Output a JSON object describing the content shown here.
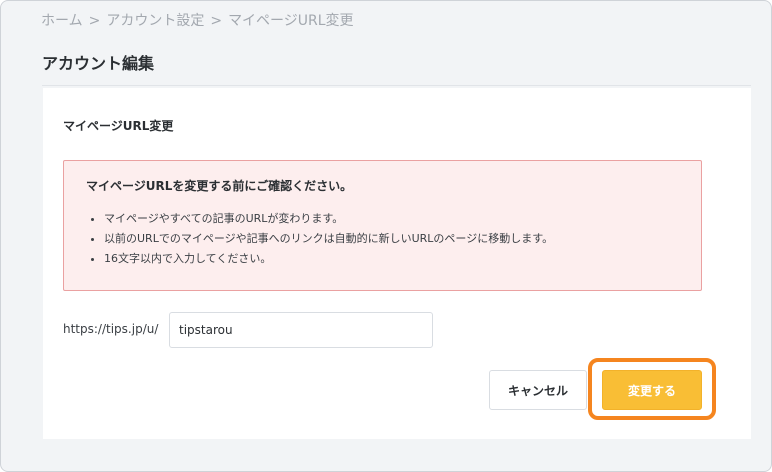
{
  "breadcrumb": {
    "items": [
      "ホーム",
      "アカウント設定",
      "マイページURL変更"
    ],
    "separator": ">"
  },
  "page": {
    "title": "アカウント編集"
  },
  "section": {
    "title": "マイページURL変更"
  },
  "alert": {
    "title": "マイページURLを変更する前にご確認ください。",
    "items": [
      "マイページやすべての記事のURLが変わります。",
      "以前のURLでのマイページや記事へのリンクは自動的に新しいURLのページに移動します。",
      "16文字以内で入力してください。"
    ]
  },
  "url": {
    "prefix": "https://tips.jp/u/",
    "value": "tipstarou"
  },
  "buttons": {
    "cancel": "キャンセル",
    "submit": "変更する"
  },
  "colors": {
    "accent": "#f9be35",
    "highlight": "#f5851f",
    "alert_bg": "#fdeeee",
    "alert_border": "#eaa1a1"
  }
}
